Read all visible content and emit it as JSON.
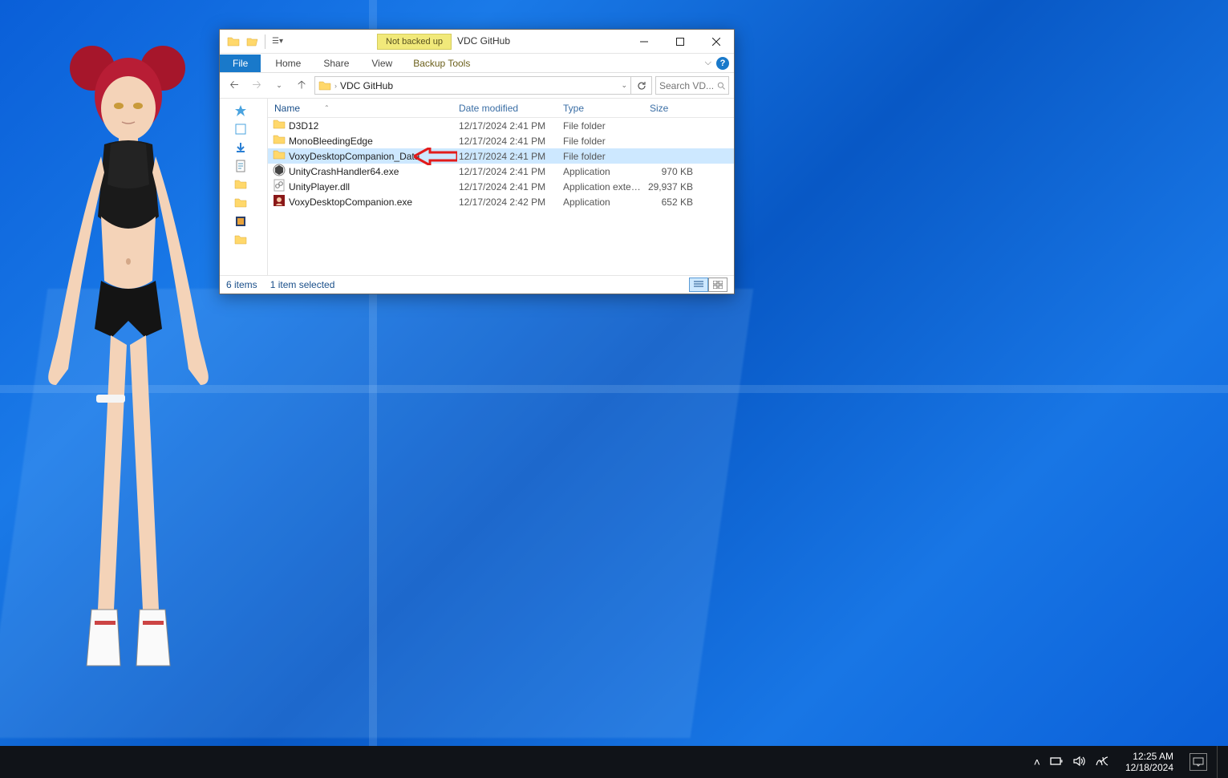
{
  "window": {
    "title": "VDC GitHub",
    "backup_badge": "Not backed up",
    "tabs": {
      "file": "File",
      "home": "Home",
      "share": "Share",
      "view": "View",
      "backup": "Backup Tools"
    }
  },
  "address": {
    "crumb": "VDC GitHub",
    "search_placeholder": "Search VD..."
  },
  "columns": {
    "name": "Name",
    "date": "Date modified",
    "type": "Type",
    "size": "Size"
  },
  "files": [
    {
      "icon": "folder",
      "name": "D3D12",
      "date": "12/17/2024 2:41 PM",
      "type": "File folder",
      "size": ""
    },
    {
      "icon": "folder",
      "name": "MonoBleedingEdge",
      "date": "12/17/2024 2:41 PM",
      "type": "File folder",
      "size": ""
    },
    {
      "icon": "folder",
      "name": "VoxyDesktopCompanion_Data",
      "date": "12/17/2024 2:41 PM",
      "type": "File folder",
      "size": "",
      "selected": true
    },
    {
      "icon": "exe-unity",
      "name": "UnityCrashHandler64.exe",
      "date": "12/17/2024 2:41 PM",
      "type": "Application",
      "size": "970 KB"
    },
    {
      "icon": "dll",
      "name": "UnityPlayer.dll",
      "date": "12/17/2024 2:41 PM",
      "type": "Application exten...",
      "size": "29,937 KB"
    },
    {
      "icon": "exe-app",
      "name": "VoxyDesktopCompanion.exe",
      "date": "12/17/2024 2:42 PM",
      "type": "Application",
      "size": "652 KB"
    }
  ],
  "status": {
    "items": "6 items",
    "selected": "1 item selected"
  },
  "tray": {
    "time": "12:25 AM",
    "date": "12/18/2024"
  }
}
